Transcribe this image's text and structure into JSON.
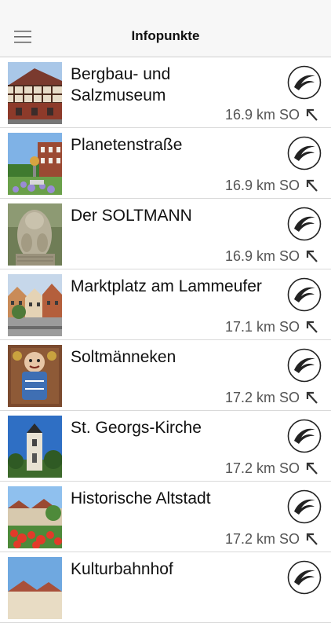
{
  "nav": {
    "title": "Infopunkte",
    "menu_icon": "hamburger-menu-icon"
  },
  "items": [
    {
      "title": "Bergbau- und\nSalzmuseum",
      "distance": "16.9 km SO",
      "image": "half-timbered-building"
    },
    {
      "title": "Planetenstraße",
      "distance": "16.9 km SO",
      "image": "planet-sculpture-park"
    },
    {
      "title": "Der SOLTMANN",
      "distance": "16.9 km SO",
      "image": "stone-statue"
    },
    {
      "title": "Marktplatz am Lammeufer",
      "distance": "17.1 km SO",
      "image": "market-square"
    },
    {
      "title": "Soltmänneken",
      "distance": "17.2 km SO",
      "image": "blue-figure-carving"
    },
    {
      "title": "St. Georgs-Kirche",
      "distance": "17.2 km SO",
      "image": "church-tower"
    },
    {
      "title": "Historische Altstadt",
      "distance": "17.2 km SO",
      "image": "old-town-flowers"
    },
    {
      "title": "Kulturbahnhof",
      "distance": "",
      "image": "station-building"
    }
  ],
  "icons": {
    "action": "route-logo-icon",
    "direction": "north-west-arrow-icon"
  }
}
